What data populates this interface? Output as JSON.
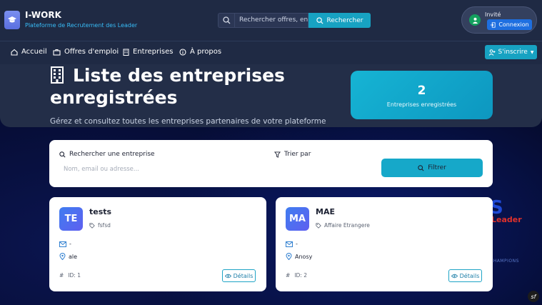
{
  "header": {
    "brand_title": "I-WORK",
    "brand_subtitle": "Plateforme de Recrutement des Leader",
    "search": {
      "value": "Rechercher offres, en",
      "button_label": "Rechercher"
    },
    "user": {
      "name": "Invité",
      "login_label": "Connexion"
    }
  },
  "nav": {
    "items": [
      {
        "label": "Accueil",
        "icon": "home-icon"
      },
      {
        "label": "Offres d'emploi",
        "icon": "briefcase-icon"
      },
      {
        "label": "Entreprises",
        "icon": "building-icon"
      },
      {
        "label": "À propos",
        "icon": "info-icon"
      }
    ],
    "signup_label": "S'inscrire"
  },
  "hero": {
    "title": "Liste des entreprises enregistrées",
    "description": "Gérez et consultez toutes les entreprises partenaires de votre plateforme",
    "stat": {
      "value": "2",
      "label": "Entreprises enregistrées"
    }
  },
  "filters": {
    "search_label": "Rechercher une entreprise",
    "search_placeholder": "Nom, email ou adresse...",
    "sort_label": "Trier par",
    "filter_button": "Filtrer"
  },
  "companies": [
    {
      "initials": "TE",
      "name": "tests",
      "sector": "fsfsd",
      "email": "-",
      "location": "ale",
      "id": "ID: 1",
      "details_label": "Détails"
    },
    {
      "initials": "MA",
      "name": "MAE",
      "sector": "Affaire Etrangere",
      "email": "-",
      "location": "Anosy",
      "id": "ID: 2",
      "details_label": "Détails"
    }
  ],
  "background_emblem": {
    "letter": "S",
    "word": "Leader",
    "tagline": "CHAMPIONS"
  },
  "colors": {
    "accent": "#17a2c2",
    "primary": "#1e6fe0",
    "header_bg": "#1f2a44",
    "page_bg": "#050b2e"
  }
}
